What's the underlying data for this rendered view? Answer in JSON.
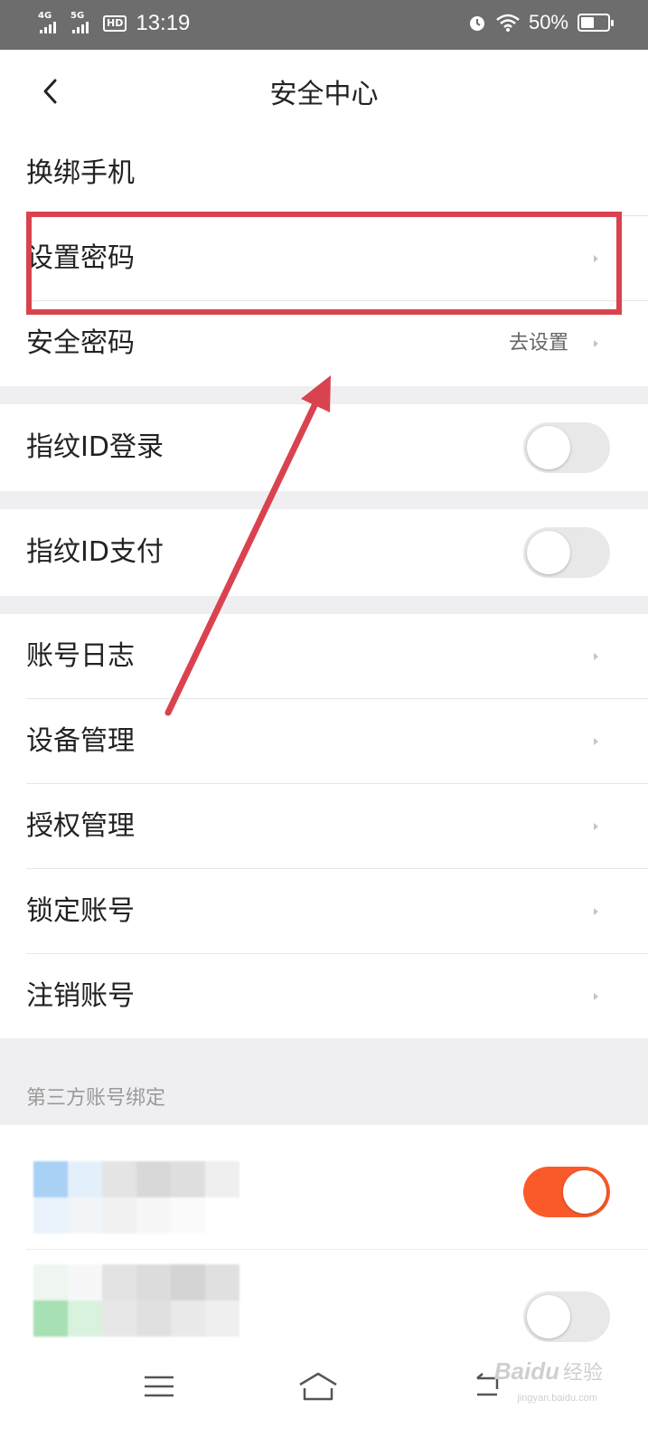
{
  "status_bar": {
    "signal_1_label": "4G",
    "signal_2_label": "5G",
    "hd_label": "HD",
    "time": "13:19",
    "battery_percent": "50%",
    "battery_level": 0.5
  },
  "header": {
    "title": "安全中心",
    "back_icon": "chevron-left-icon"
  },
  "menu": {
    "items": [
      {
        "label": "换绑手机"
      },
      {
        "label": "设置密码"
      },
      {
        "label": "安全密码",
        "value": "去设置"
      }
    ]
  },
  "toggles": [
    {
      "label": "指纹ID登录",
      "on": false
    },
    {
      "label": "指纹ID支付",
      "on": false
    }
  ],
  "account_items": [
    {
      "label": "账号日志"
    },
    {
      "label": "设备管理"
    },
    {
      "label": "授权管理"
    },
    {
      "label": "锁定账号"
    },
    {
      "label": "注销账号"
    }
  ],
  "third_party": {
    "section_title": "第三方账号绑定",
    "items": [
      {
        "on": true
      },
      {
        "on": false
      }
    ]
  },
  "colors": {
    "toggle_on": "#fa5a2a",
    "toggle_off": "#e8e8e8",
    "annotation": "#d9434f",
    "section_bg": "#efeff2"
  },
  "nav_bar": {
    "icons": [
      "menu-icon",
      "home-icon",
      "back-icon"
    ]
  },
  "watermark": {
    "logo": "Baidu",
    "text": "经验",
    "url": "jingyan.baidu.com"
  }
}
